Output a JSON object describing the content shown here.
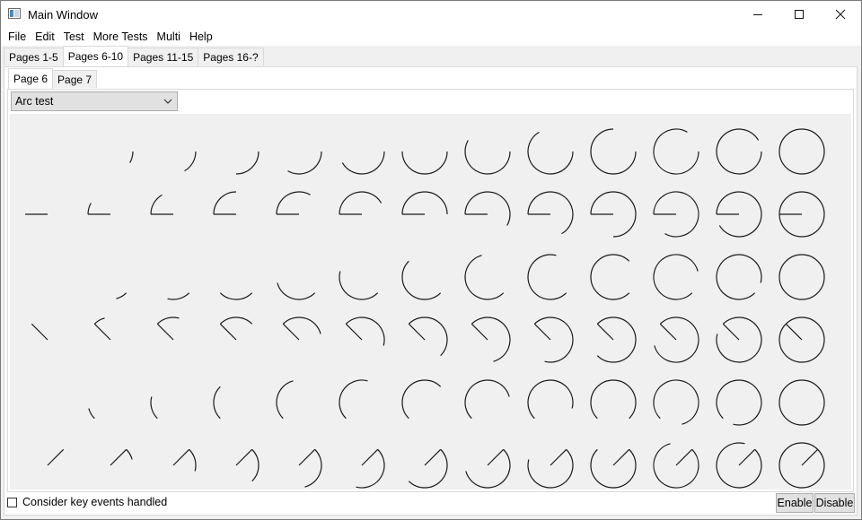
{
  "window": {
    "title": "Main Window",
    "icons": {
      "app": "app-window-icon",
      "minimize": "minimize-icon",
      "maximize": "maximize-icon",
      "close": "close-icon"
    }
  },
  "menubar": {
    "items": [
      {
        "label": "File"
      },
      {
        "label": "Edit"
      },
      {
        "label": "Test"
      },
      {
        "label": "More Tests"
      },
      {
        "label": "Multi"
      },
      {
        "label": "Help"
      }
    ]
  },
  "outer_tabs": [
    {
      "label": "Pages 1-5",
      "active": false
    },
    {
      "label": "Pages 6-10",
      "active": true
    },
    {
      "label": "Pages 11-15",
      "active": false
    },
    {
      "label": "Pages 16-?",
      "active": false
    }
  ],
  "inner_tabs": [
    {
      "label": "Page 6",
      "active": true
    },
    {
      "label": "Page 7",
      "active": false
    }
  ],
  "combo": {
    "selected": "Arc test",
    "arrow_icon": "chevron-down-icon"
  },
  "arc_grid": {
    "rows": 6,
    "cols": 13,
    "row_start_angles_deg": [
      0,
      180,
      45,
      225,
      135,
      315
    ],
    "sweep_step_deg": 30,
    "row_draws_center_line": [
      false,
      true,
      false,
      true,
      false,
      true
    ],
    "stroke_color": "#1a1a1a"
  },
  "bottom": {
    "checkbox_label": "Consider key events handled",
    "checkbox_checked": false,
    "enable_label": "Enable",
    "disable_label": "Disable"
  }
}
